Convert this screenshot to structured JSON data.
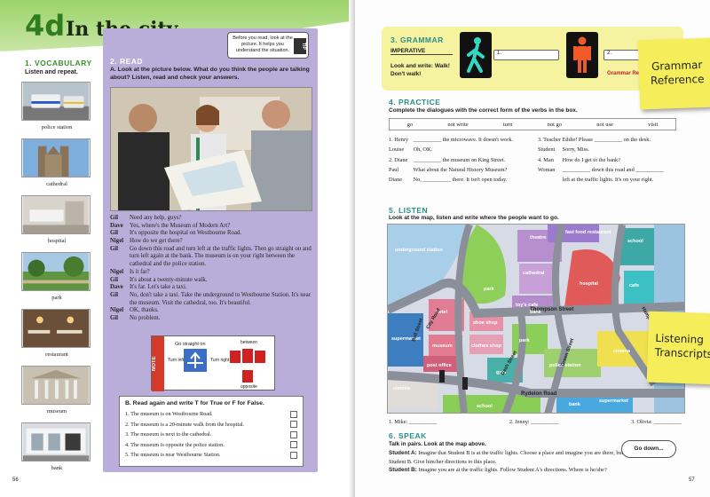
{
  "header": {
    "unit_number": "4d",
    "unit_title": "In the city"
  },
  "vocabulary": {
    "title": "1. VOCABULARY",
    "instruction": "Listen and repeat.",
    "items": [
      {
        "label": "police station"
      },
      {
        "label": "cathedral"
      },
      {
        "label": "hospital"
      },
      {
        "label": "park"
      },
      {
        "label": "restaurant"
      },
      {
        "label": "museum"
      },
      {
        "label": "bank"
      }
    ]
  },
  "read": {
    "title": "2. READ",
    "instruction": "A. Look at the picture below. What do you think the people are talking about? Listen, read and check your answers.",
    "tip": {
      "tag": "TIP",
      "text": "Before you read, look at the picture. It helps you understand the situation."
    },
    "dialogue": [
      {
        "speaker": "Gil",
        "text": "Need any help, guys?"
      },
      {
        "speaker": "Dave",
        "text": "Yes, where's the Museum of Modern Art?"
      },
      {
        "speaker": "Gil",
        "text": "It's opposite the hospital on Westbourne Road."
      },
      {
        "speaker": "Nigel",
        "text": "How do we get there?"
      },
      {
        "speaker": "Gil",
        "text": "Go down this road and turn left at the traffic lights. Then go straight on and turn left again at the bank. The museum is on your right between the cathedral and the police station."
      },
      {
        "speaker": "Nigel",
        "text": "Is it far?"
      },
      {
        "speaker": "Gil",
        "text": "It's about a twenty-minute walk."
      },
      {
        "speaker": "Dave",
        "text": "It's far. Let's take a taxi."
      },
      {
        "speaker": "Gil",
        "text": "No, don't take a taxi. Take the underground to Westbourne Station. It's near the museum. Visit the cathedral, too. It's beautiful."
      },
      {
        "speaker": "Nigel",
        "text": "OK, thanks."
      },
      {
        "speaker": "Gil",
        "text": "No problem."
      }
    ],
    "note": {
      "tag": "NOTE",
      "go_straight_on": "Go straight on",
      "turn_left": "Turn left",
      "turn_right": "Turn right",
      "between": "between",
      "opposite": "opposite"
    },
    "true_false": {
      "title": "B. Read again and write T for True or F for False.",
      "items": [
        "1. The museum is on Westbourne Road.",
        "2. The museum is a 20-minute walk from the hospital.",
        "3. The museum is next to the cathedral.",
        "4. The museum is opposite the police station.",
        "5. The museum is near Westbourne Station."
      ]
    },
    "page_number": "56"
  },
  "grammar": {
    "title": "3. GRAMMAR",
    "imperative": "IMPERATIVE",
    "look_write": "Look and write: Walk! Don't walk!",
    "box1": "1.",
    "box2": "2.",
    "reference_link": "Grammar Reference",
    "sticky": "Grammar Reference"
  },
  "practice": {
    "title": "4. PRACTICE",
    "instruction": "Complete the dialogues with the correct form of the verbs in the box.",
    "words": [
      "go",
      "not write",
      "turn",
      "not go",
      "not use",
      "visit"
    ],
    "dialogues_left": [
      {
        "speaker": "1. Henry",
        "text": "__________ the microwave. It doesn't work."
      },
      {
        "speaker": "Louise",
        "text": "Oh, OK."
      },
      {
        "speaker": "2. Diane",
        "text": "__________ the museum on King Street."
      },
      {
        "speaker": "Paul",
        "text": "What about the Natural History Museum?"
      },
      {
        "speaker": "Diane",
        "text": "No, __________ there. It isn't open today."
      }
    ],
    "dialogues_right": [
      {
        "speaker": "3. Teacher",
        "text": "Eddie! Please __________ on the desk."
      },
      {
        "speaker": "Student",
        "text": "Sorry, Miss."
      },
      {
        "speaker": "4. Man",
        "text": "How do I get to the bank?"
      },
      {
        "speaker": "Woman",
        "text": "__________ down this road and __________"
      },
      {
        "speaker": "",
        "text": "left at the traffic lights. It's on your right."
      }
    ]
  },
  "listen": {
    "title": "5. LISTEN",
    "instruction": "Look at the map, listen and write where the people want to go.",
    "map": {
      "places": [
        "underground station",
        "fast food restaurant",
        "school",
        "theatre",
        "cafe",
        "cathedral",
        "park",
        "toy's cafe",
        "hospital",
        "bank",
        "hotel",
        "shoe shop",
        "clothes shop",
        "museum",
        "post office",
        "supermarket",
        "park",
        "gym",
        "police station",
        "cinema",
        "cinema",
        "school",
        "bank",
        "supermarket"
      ],
      "streets": [
        "Thompson Street",
        "Green Street",
        "Rydelon Road",
        "Dash Street",
        "Bell Street",
        "City Road",
        "Hampton Road"
      ]
    },
    "answers": [
      "1. Mike: __________",
      "2. Jenny: __________",
      "3. Olivia: __________"
    ],
    "sticky": "Listening Transcripts"
  },
  "speak": {
    "title": "6. SPEAK",
    "instruction": "Talk in pairs. Look at the map above.",
    "student_a_label": "Student A:",
    "student_a": "Imagine that Student B is at the traffic lights. Choose a place and imagine you are there, but don't tell Student B. Give him/her directions to this place.",
    "student_b_label": "Student B:",
    "student_b": "Imagine you are at the traffic lights. Follow Student A's directions. Where is he/she?",
    "bubble": "Go down...",
    "page_number": "57"
  },
  "colors": {
    "purple_panel": "#b9aed9",
    "grammar_box": "#f6f3a0",
    "sticky": "#f5ee5a",
    "green_title": "#3a8f2a"
  }
}
